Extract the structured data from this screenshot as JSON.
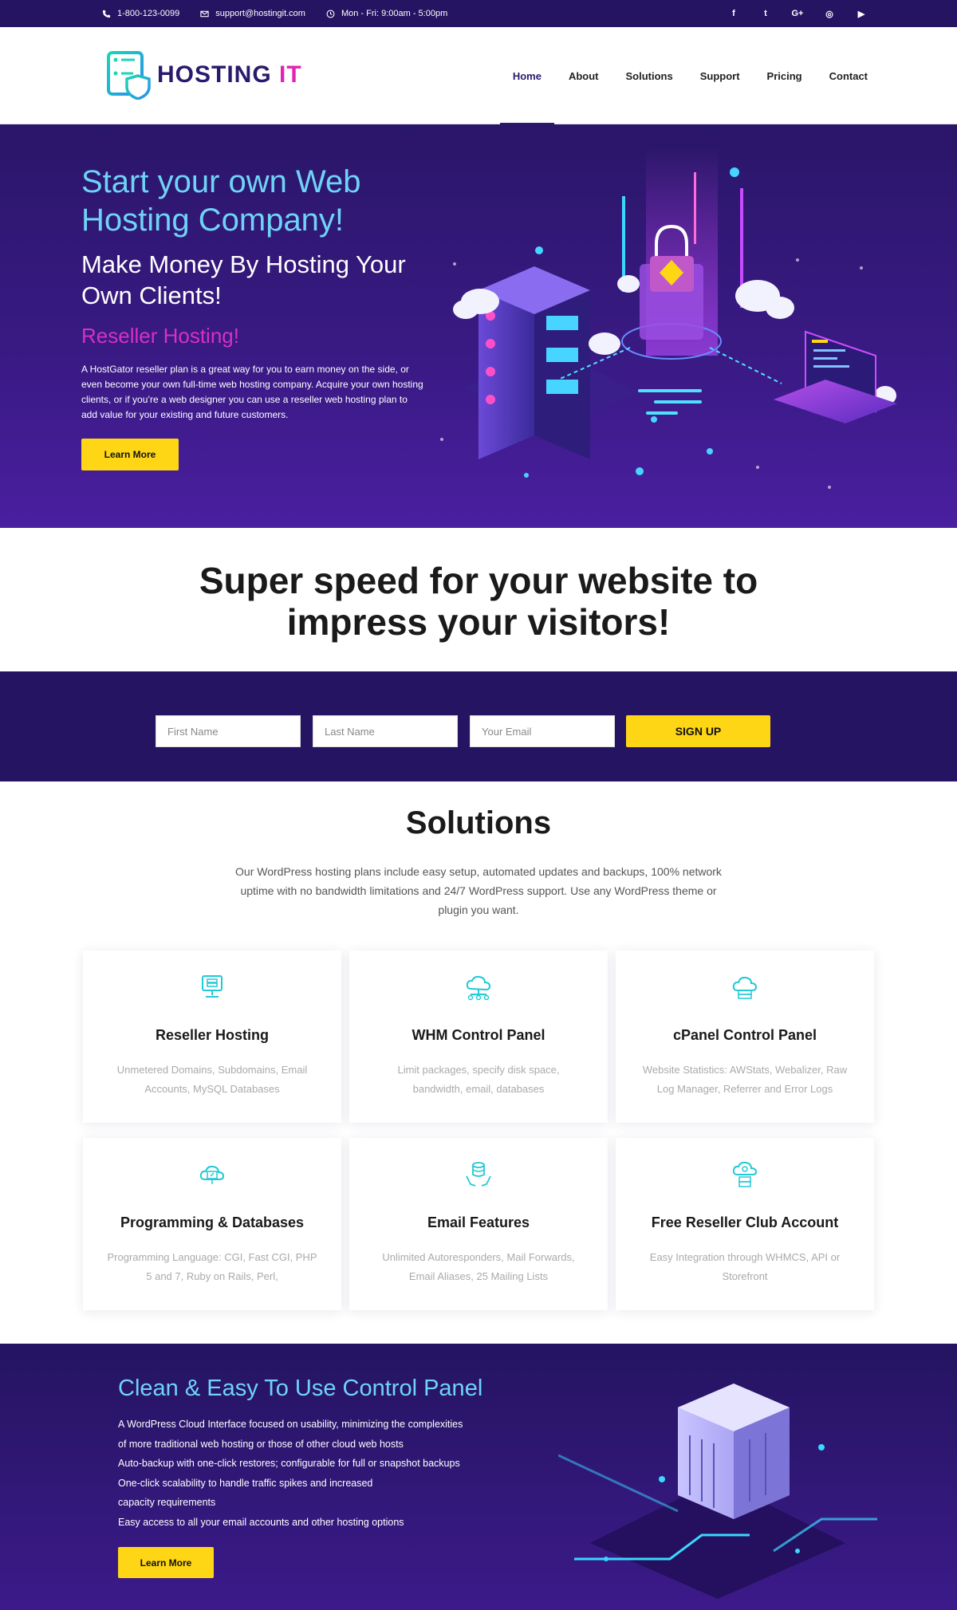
{
  "topbar": {
    "phone": "1-800-123-0099",
    "email": "support@hostingit.com",
    "hours": "Mon - Fri: 9:00am - 5:00pm",
    "social": [
      "f",
      "t",
      "G+",
      "◎",
      "▶"
    ]
  },
  "brand": {
    "name": "HOSTING",
    "accent": "IT",
    "primary_color": "#2a1a6e",
    "accent_color": "#e024b8"
  },
  "nav": {
    "items": [
      {
        "label": "Home"
      },
      {
        "label": "About"
      },
      {
        "label": "Solutions"
      },
      {
        "label": "Support"
      },
      {
        "label": "Pricing"
      },
      {
        "label": "Contact"
      }
    ]
  },
  "hero": {
    "title": "Start your own Web Hosting Company!",
    "subtitle": "Make Money By Hosting Your Own Clients!",
    "tagline": "Reseller Hosting!",
    "body": "A HostGator reseller plan is a great way for you to earn money on the side, or even become your own full-time web hosting company. Acquire your own hosting clients, or if you’re a web designer you can use a reseller web hosting plan to add value for your existing and future customers.",
    "cta": "Learn More"
  },
  "speed": {
    "headline": "Super speed for your website to impress your visitors!"
  },
  "signup": {
    "first_name": "First Name",
    "last_name": "Last Name",
    "email": "Your Email",
    "button": "SIGN UP"
  },
  "solutions": {
    "title": "Solutions",
    "description": "Our WordPress hosting plans include easy setup, automated updates and backups, 100% network uptime with no bandwidth limitations and 24/7 WordPress support. Use any WordPress theme or plugin you want.",
    "cards": [
      {
        "title": "Reseller Hosting",
        "text": "Unmetered Domains, Subdomains, Email Accounts, MySQL Databases",
        "icon": "server-monitor-icon"
      },
      {
        "title": "WHM Control Panel",
        "text": "Limit packages, specify disk space, bandwidth, email, databases",
        "icon": "cloud-network-icon"
      },
      {
        "title": "cPanel Control Panel",
        "text": "Website Statistics: AWStats, Webalizer, Raw Log Manager, Referrer and Error Logs",
        "icon": "cloud-server-icon"
      },
      {
        "title": "Programming & Databases",
        "text": "Programming Language: CGI, Fast CGI, PHP 5 and 7, Ruby on Rails, Perl,",
        "icon": "cloud-code-icon"
      },
      {
        "title": "Email Features",
        "text": "Unlimited Autoresponders, Mail Forwards, Email Aliases, 25 Mailing Lists",
        "icon": "hands-database-icon"
      },
      {
        "title": "Free Reseller Club Account",
        "text": "Easy Integration through WHMCS, API or Storefront",
        "icon": "cloud-user-icon"
      }
    ]
  },
  "cpanel": {
    "title": "Clean & Easy To Use Control Panel",
    "lines": [
      "A WordPress Cloud Interface focused on usability, minimizing the complexities",
      "of more traditional web hosting or those of other cloud web hosts",
      "Auto-backup with one-click restores; configurable for full or snapshot backups",
      "One-click scalability to handle traffic spikes and increased",
      "capacity requirements",
      "Easy access to all your email accounts and other hosting options"
    ],
    "cta": "Learn More"
  }
}
